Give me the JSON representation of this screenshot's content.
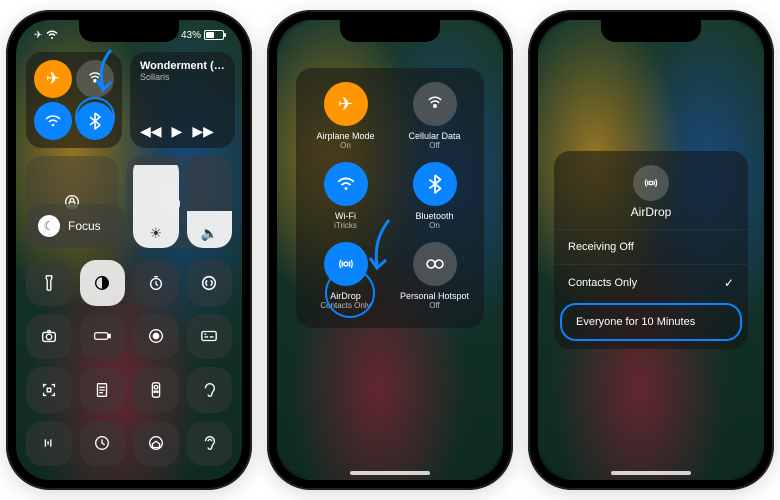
{
  "status": {
    "battery_pct_label": "43%",
    "battery_pct": 43,
    "airplane_icon": "airplane",
    "wifi_icon": "wifi"
  },
  "phone1": {
    "connectivity": {
      "airplane": {
        "on": true
      },
      "cellular": {
        "on": false
      },
      "wifi": {
        "on": true
      },
      "bluetooth": {
        "on": true
      }
    },
    "now_playing": {
      "title": "Wonderment (…",
      "artist": "Sollaris"
    },
    "focus_label": "Focus",
    "icons": [
      "orientation-lock",
      "screen-mirroring",
      "flashlight",
      "dark-mode",
      "timer",
      "shazam",
      "camera",
      "low-power",
      "screen-record",
      "captions",
      "qr-scan",
      "notes",
      "apple-tv-remote",
      "hearing",
      "voice-memo",
      "clock",
      "home",
      "ear"
    ]
  },
  "phone2": {
    "items": [
      {
        "id": "airplane",
        "label": "Airplane Mode",
        "sub": "On",
        "color": "orange"
      },
      {
        "id": "cellular",
        "label": "Cellular Data",
        "sub": "Off",
        "color": "grey"
      },
      {
        "id": "wifi",
        "label": "Wi-Fi",
        "sub": "iTricks",
        "color": "blue"
      },
      {
        "id": "bluetooth",
        "label": "Bluetooth",
        "sub": "On",
        "color": "blue"
      },
      {
        "id": "airdrop",
        "label": "AirDrop",
        "sub": "Contacts Only",
        "color": "blue"
      },
      {
        "id": "hotspot",
        "label": "Personal Hotspot",
        "sub": "Off",
        "color": "grey"
      }
    ]
  },
  "phone3": {
    "title": "AirDrop",
    "options": [
      {
        "label": "Receiving Off",
        "selected": false,
        "highlight": false
      },
      {
        "label": "Contacts Only",
        "selected": true,
        "highlight": false
      },
      {
        "label": "Everyone for 10 Minutes",
        "selected": false,
        "highlight": true
      }
    ]
  }
}
